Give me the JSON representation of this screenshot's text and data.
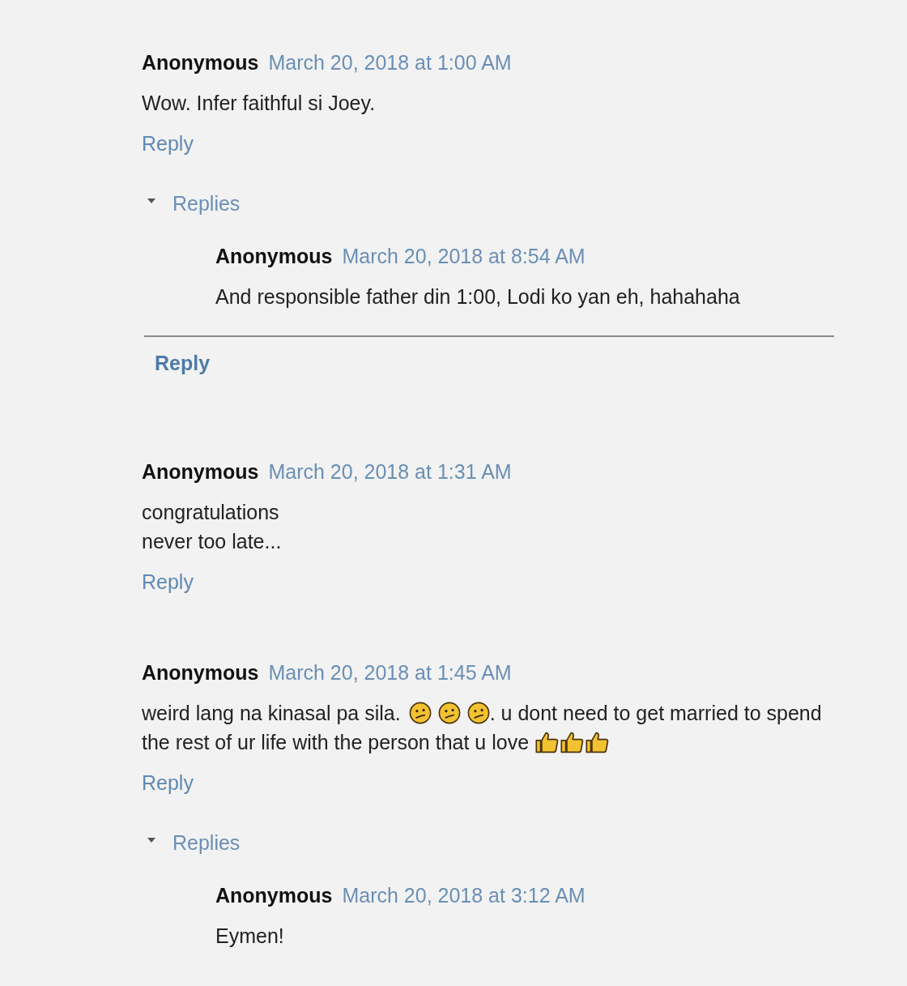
{
  "comments": [
    {
      "author": "Anonymous",
      "date": "March 20, 2018 at 1:00 AM",
      "lines": [
        [
          {
            "kind": "text",
            "text": "Wow. Infer faithful si Joey."
          }
        ]
      ],
      "reply_link": "Reply",
      "replies": {
        "toggle": "Replies",
        "expanded": true,
        "items": [
          {
            "author": "Anonymous",
            "date": "March 20, 2018 at 8:54 AM",
            "lines": [
              [
                {
                  "kind": "text",
                  "text": "And responsible father din 1:00, Lodi ko yan eh, hahahaha"
                }
              ]
            ]
          }
        ],
        "footer_reply": "Reply"
      }
    },
    {
      "author": "Anonymous",
      "date": "March 20, 2018 at 1:31 AM",
      "lines": [
        [
          {
            "kind": "text",
            "text": "congratulations"
          }
        ],
        [
          {
            "kind": "text",
            "text": "never too late..."
          }
        ]
      ],
      "reply_link": "Reply"
    },
    {
      "author": "Anonymous",
      "date": "March 20, 2018 at 1:45 AM",
      "lines": [
        [
          {
            "kind": "text",
            "text": "weird lang na kinasal pa sila."
          },
          {
            "kind": "confused"
          },
          {
            "kind": "confused"
          },
          {
            "kind": "confused"
          },
          {
            "kind": "text",
            "text": ". u dont need to get married to spend"
          }
        ],
        [
          {
            "kind": "text",
            "text": "the rest of ur life with the person that u love"
          },
          {
            "kind": "thumbsup"
          },
          {
            "kind": "thumbsup"
          },
          {
            "kind": "thumbsup"
          }
        ]
      ],
      "reply_link": "Reply",
      "replies": {
        "toggle": "Replies",
        "expanded": true,
        "items": [
          {
            "author": "Anonymous",
            "date": "March 20, 2018 at 3:12 AM",
            "lines": [
              [
                {
                  "kind": "text",
                  "text": "Eymen!"
                }
              ]
            ]
          }
        ]
      }
    }
  ]
}
